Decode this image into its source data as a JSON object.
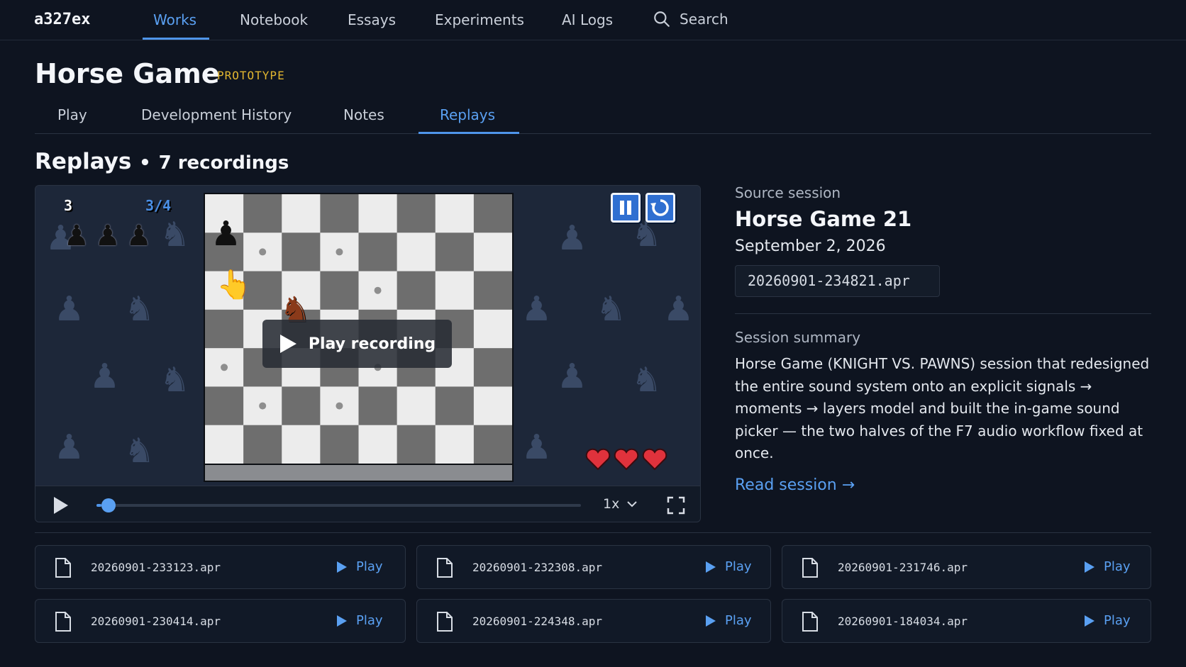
{
  "nav": {
    "brand": "a327ex",
    "items": [
      {
        "label": "Works",
        "active": true
      },
      {
        "label": "Notebook",
        "active": false
      },
      {
        "label": "Essays",
        "active": false
      },
      {
        "label": "Experiments",
        "active": false
      },
      {
        "label": "AI Logs",
        "active": false
      }
    ],
    "search_label": "Search",
    "search_icon": "search-icon"
  },
  "page": {
    "title": "Horse Game",
    "badge": "PROTOTYPE",
    "tabs": [
      {
        "label": "Play",
        "active": false
      },
      {
        "label": "Development History",
        "active": false
      },
      {
        "label": "Notes",
        "active": false
      },
      {
        "label": "Replays",
        "active": true
      }
    ]
  },
  "replays": {
    "heading": "Replays",
    "separator": "•",
    "count": "7 recordings"
  },
  "player": {
    "hud_score": "3",
    "hud_progress": "3/4",
    "overlay_label": "Play recording",
    "speed": "1x",
    "progress_fraction": 0.01,
    "hearts": 3,
    "pawns_remaining": 3,
    "colors": {
      "accent": "#4f95ea",
      "heart": "#e0323c",
      "board_light": "#ececec",
      "board_dark": "#6e6e6e"
    },
    "icons": [
      "play-icon",
      "pause-icon",
      "restart-icon",
      "fullscreen-icon",
      "chevron-down-icon",
      "hand-pointer-icon",
      "horse-icon",
      "pawn-icon",
      "heart-icon"
    ]
  },
  "session": {
    "source_label": "Source session",
    "title": "Horse Game 21",
    "date": "September 2, 2026",
    "file": "20260901-234821.apr",
    "summary_label": "Session summary",
    "summary": "Horse Game (KNIGHT VS. PAWNS) session that redesigned the entire sound system onto an explicit signals → moments → layers model and built the in-game sound picker — the two halves of the F7 audio workflow fixed at once.",
    "read_link": "Read session →"
  },
  "recordings": [
    {
      "file": "20260901-233123.apr",
      "action": "Play"
    },
    {
      "file": "20260901-232308.apr",
      "action": "Play"
    },
    {
      "file": "20260901-231746.apr",
      "action": "Play"
    },
    {
      "file": "20260901-230414.apr",
      "action": "Play"
    },
    {
      "file": "20260901-224348.apr",
      "action": "Play"
    },
    {
      "file": "20260901-184034.apr",
      "action": "Play"
    }
  ]
}
